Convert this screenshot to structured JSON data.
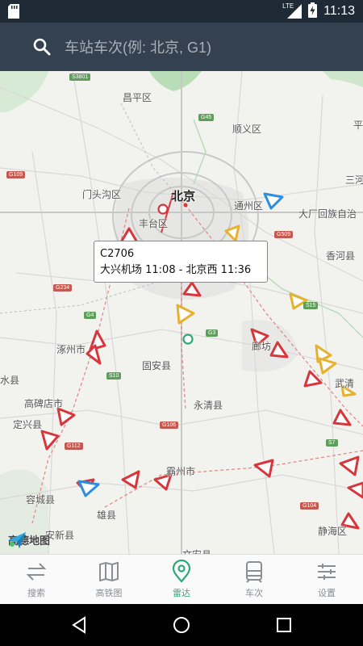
{
  "status_bar": {
    "time": "11:13",
    "network": "LTE"
  },
  "search": {
    "placeholder": "车站车次(例: 北京, G1)"
  },
  "map": {
    "places": [
      {
        "id": "changping",
        "label": "昌平区"
      },
      {
        "id": "shunyi",
        "label": "顺义区"
      },
      {
        "id": "ping",
        "label": "平"
      },
      {
        "id": "mentougou",
        "label": "门头沟区"
      },
      {
        "id": "beijing",
        "label": "北京"
      },
      {
        "id": "tongzhou",
        "label": "通州区"
      },
      {
        "id": "sanhe",
        "label": "三河"
      },
      {
        "id": "dachang",
        "label": "大厂回族自治"
      },
      {
        "id": "fengtai",
        "label": "丰台区"
      },
      {
        "id": "xianghe",
        "label": "香河县"
      },
      {
        "id": "zhuozhou",
        "label": "涿州市"
      },
      {
        "id": "guan",
        "label": "固安县"
      },
      {
        "id": "langfang",
        "label": "廊坊"
      },
      {
        "id": "wuqing",
        "label": "武清"
      },
      {
        "id": "shui",
        "label": "水县"
      },
      {
        "id": "gaobeidian",
        "label": "高碑店市"
      },
      {
        "id": "dingxing",
        "label": "定兴县"
      },
      {
        "id": "yongqing",
        "label": "永清县"
      },
      {
        "id": "bazhou",
        "label": "霸州市"
      },
      {
        "id": "rongcheng",
        "label": "容城县"
      },
      {
        "id": "xiongxian",
        "label": "雄县"
      },
      {
        "id": "anxin",
        "label": "安新县"
      },
      {
        "id": "jinghai",
        "label": "静海区"
      },
      {
        "id": "wenan",
        "label": "文安县"
      }
    ],
    "route_tags": [
      {
        "id": "s3801",
        "label": "S3801",
        "color": "green"
      },
      {
        "id": "g45",
        "label": "G45",
        "color": "green"
      },
      {
        "id": "g109",
        "label": "G109",
        "color": "red"
      },
      {
        "id": "g509",
        "label": "G509",
        "color": "red"
      },
      {
        "id": "s15",
        "label": "S15",
        "color": "green"
      },
      {
        "id": "g234",
        "label": "G234",
        "color": "red"
      },
      {
        "id": "g4",
        "label": "G4",
        "color": "green"
      },
      {
        "id": "g3",
        "label": "G3",
        "color": "green"
      },
      {
        "id": "s10",
        "label": "S10",
        "color": "green"
      },
      {
        "id": "g106",
        "label": "G106",
        "color": "red"
      },
      {
        "id": "g112",
        "label": "G112",
        "color": "red"
      },
      {
        "id": "s7",
        "label": "S7",
        "color": "green"
      },
      {
        "id": "g104",
        "label": "G104",
        "color": "red"
      }
    ],
    "tooltip": {
      "train": "C2706",
      "route": "大兴机场 11:08 - 北京西 11:36"
    },
    "logo_text": "高德地图",
    "colors": {
      "red_train": "#d6363c",
      "yellow_train": "#e6b22e",
      "blue_train": "#2b8ee0",
      "station": "#2fa878"
    }
  },
  "bottom_nav": {
    "items": [
      {
        "id": "search",
        "label": "搜索"
      },
      {
        "id": "map",
        "label": "高铁图"
      },
      {
        "id": "radar",
        "label": "雷达"
      },
      {
        "id": "trains",
        "label": "车次"
      },
      {
        "id": "settings",
        "label": "设置"
      }
    ],
    "active": "radar",
    "active_color": "#2fa878"
  }
}
